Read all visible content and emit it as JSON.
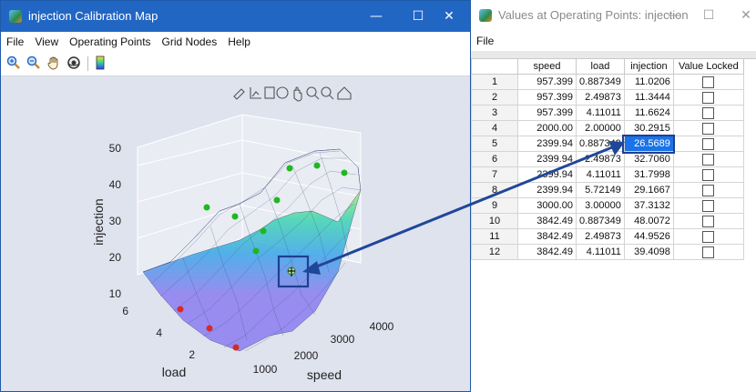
{
  "left_window": {
    "title": "injection Calibration Map",
    "menu": [
      "File",
      "View",
      "Operating Points",
      "Grid Nodes",
      "Help"
    ],
    "controls": {
      "minimize": "—",
      "maximize": "☐",
      "close": "✕"
    }
  },
  "right_window": {
    "title": "Values at Operating Points: injection",
    "menu": [
      "File"
    ],
    "controls": {
      "minimize": "—",
      "maximize": "☐",
      "close": "✕"
    }
  },
  "table": {
    "columns": [
      "",
      "speed",
      "load",
      "injection",
      "Value Locked"
    ],
    "rows": [
      {
        "n": "1",
        "speed": "957.399",
        "load": "0.887349",
        "injection": "11.0206"
      },
      {
        "n": "2",
        "speed": "957.399",
        "load": "2.49873",
        "injection": "11.3444"
      },
      {
        "n": "3",
        "speed": "957.399",
        "load": "4.11011",
        "injection": "11.6624"
      },
      {
        "n": "4",
        "speed": "2000.00",
        "load": "2.00000",
        "injection": "30.2915"
      },
      {
        "n": "5",
        "speed": "2399.94",
        "load": "0.887349",
        "injection": "26.5689"
      },
      {
        "n": "6",
        "speed": "2399.94",
        "load": "2.49873",
        "injection": "32.7060"
      },
      {
        "n": "7",
        "speed": "2399.94",
        "load": "4.11011",
        "injection": "31.7998"
      },
      {
        "n": "8",
        "speed": "2399.94",
        "load": "5.72149",
        "injection": "29.1667"
      },
      {
        "n": "9",
        "speed": "3000.00",
        "load": "3.00000",
        "injection": "37.3132"
      },
      {
        "n": "10",
        "speed": "3842.49",
        "load": "0.887349",
        "injection": "48.0072"
      },
      {
        "n": "11",
        "speed": "3842.49",
        "load": "2.49873",
        "injection": "44.9526"
      },
      {
        "n": "12",
        "speed": "3842.49",
        "load": "4.11011",
        "injection": "39.4098"
      }
    ],
    "selected_row": 5
  },
  "chart_data": {
    "type": "surface",
    "xlabel": "speed",
    "ylabel": "load",
    "zlabel": "injection",
    "x_ticks": [
      "1000",
      "2000",
      "3000",
      "4000"
    ],
    "y_ticks": [
      "2",
      "4",
      "6"
    ],
    "z_ticks": [
      "10",
      "20",
      "30",
      "40",
      "50"
    ],
    "zlim": [
      10,
      50
    ],
    "colormap": "parula",
    "point_colors": {
      "red": "#d42a2a",
      "green": "#1fb81f",
      "selected": "#b8e0a0"
    }
  },
  "colors": {
    "title_blue": "#2266c4",
    "figure_bg": "#dfe3ee",
    "selection_blue": "#1a73e8",
    "arrow": "#1f4799"
  }
}
